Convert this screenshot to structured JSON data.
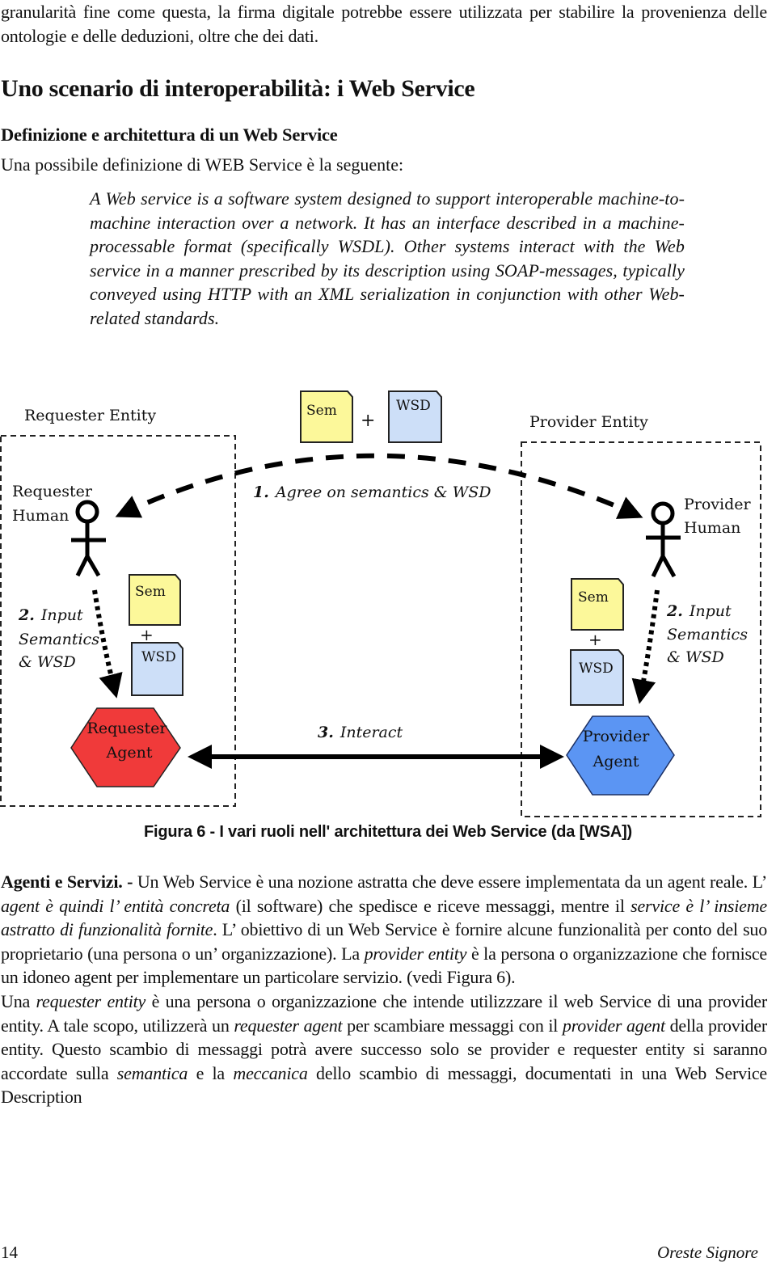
{
  "intro": {
    "text": "granularità fine come questa, la firma digitale potrebbe essere utilizzata per stabilire la provenienza delle ontologie e delle deduzioni, oltre che dei dati."
  },
  "section": {
    "title": "Uno scenario di interoperabilità: i Web Service",
    "subtitle": "Definizione e architettura di un Web Service",
    "lead": "Una possibile definizione di WEB Service è la seguente:",
    "quote": "A Web service is a software system designed to support interoperable machine-to-machine interaction over a network. It has an interface described in a machine-processable format (specifically WSDL). Other systems interact with the Web service in a manner prescribed by its description using SOAP-messages, typically conveyed using HTTP with an XML serialization in conjunction with other Web-related standards."
  },
  "figure": {
    "requester_entity_label": "Requester Entity",
    "provider_entity_label": "Provider Entity",
    "requester_human_line1": "Requester",
    "requester_human_line2": "Human",
    "provider_human_line1": "Provider",
    "provider_human_line2": "Human",
    "step1_num": "1.",
    "step1_text": "Agree on semantics & WSD",
    "step2_num": "2.",
    "step2_line1": "Input",
    "step2_line2": "Semantics",
    "step2_line3": "& WSD",
    "step3_num": "3.",
    "step3_text": "Interact",
    "sem_doc": "Sem",
    "wsd_doc": "WSD",
    "plus": "+",
    "requester_agent_line1": "Requester",
    "requester_agent_line2": "Agent",
    "provider_agent_line1": "Provider",
    "provider_agent_line2": "Agent",
    "colors": {
      "sem_doc": "#fcf89a",
      "wsd_doc": "#cddff8",
      "requester_agent": "#f03a3a",
      "provider_agent": "#5b95f3"
    },
    "caption": "Figura 6 - I vari ruoli nell' architettura dei Web Service (da [WSA])"
  },
  "body": {
    "p1_lead": "Agenti e Servizi. -",
    "p1_a": " Un Web Service è una nozione astratta che deve essere implementata da un agent reale. L’ ",
    "p1_i1": "agent è quindi l’ entità concreta",
    "p1_b": " (il software) che spedisce e riceve messaggi, mentre il ",
    "p1_i2": "service è l’ insieme astratto di funzionalità fornite",
    "p1_c": ". L’ obiettivo di un Web Service è fornire alcune funzionalità per conto del suo proprietario (una persona o un’ organizzazione). La ",
    "p1_i3": "provider entity",
    "p1_d": " è la persona o organizzazione che fornisce un idoneo agent per implementare un particolare servizio. (vedi Figura 6).",
    "p2_a": "Una ",
    "p2_i1": "requester entity",
    "p2_b": " è una persona o organizzazione che intende utilizzzare il web Service di una provider entity. A tale scopo, utilizzerà un ",
    "p2_i2": "requester agent",
    "p2_c": " per scambiare messaggi con il ",
    "p2_i3": "provider agent",
    "p2_d": " della provider entity. Questo scambio di messaggi potrà avere successo solo se provider e requester entity si saranno accordate sulla ",
    "p2_i4": "semantica",
    "p2_e": " e la ",
    "p2_i5": "meccanica",
    "p2_f": " dello scambio di messaggi, documentati in una Web Service Description"
  },
  "footer": {
    "page_number": "14",
    "author": "Oreste Signore"
  }
}
